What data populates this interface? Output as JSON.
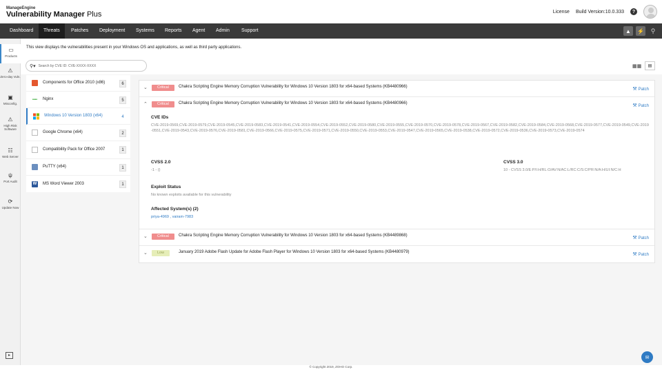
{
  "header": {
    "brand_small": "ManageEngine",
    "brand_name_bold": "Vulnerability Manager",
    "brand_name_light": " Plus",
    "license_label": "License",
    "build_version": "Build Version:10.0.333",
    "help_glyph": "?"
  },
  "nav": {
    "items": [
      "Dashboard",
      "Threats",
      "Patches",
      "Deployment",
      "Systems",
      "Reports",
      "Agent",
      "Admin",
      "Support"
    ],
    "active": "Threats"
  },
  "rail": {
    "items": [
      {
        "label": "Products",
        "icon": "laptop-icon"
      },
      {
        "label": "Zero-day Vuln.",
        "icon": "warning-icon"
      },
      {
        "label": "Misconfig.",
        "icon": "monitor-icon"
      },
      {
        "label": "High Risk Software",
        "icon": "alert-icon"
      },
      {
        "label": "Web Server",
        "icon": "server-icon"
      },
      {
        "label": "Port Audit",
        "icon": "usb-icon"
      },
      {
        "label": "Update Now",
        "icon": "refresh-icon"
      }
    ]
  },
  "intro_text": "This view displays the vulnerabilities present in your Windows OS and applications, as well as third party applications.",
  "search": {
    "placeholder": "Search by CVE ID: CVE-XXXX-XXXX"
  },
  "products": [
    {
      "name": "Components for Office 2010 (x86)",
      "count": "6",
      "icon": "office-icon"
    },
    {
      "name": "Nginx",
      "count": "5",
      "icon": "nginx-icon"
    },
    {
      "name": "Windows 10 Version 1803 (x64)",
      "count": "4",
      "icon": "windows-icon",
      "active": true
    },
    {
      "name": "Google Chrome (x64)",
      "count": "2",
      "icon": "file-icon"
    },
    {
      "name": "Compatibility Pack for Office 2007",
      "count": "1",
      "icon": "file-icon"
    },
    {
      "name": "PuTTY (x64)",
      "count": "1",
      "icon": "putty-icon"
    },
    {
      "name": "MS Word Viewer 2003",
      "count": "1",
      "icon": "word-icon"
    }
  ],
  "vulnerabilities": [
    {
      "severity": "Critical",
      "title": "Chakra Scripting Engine Memory Corruption Vulnerability for Windows 10 Version 1803 for x64-based Systems (KB4480966)",
      "action": "Patch"
    },
    {
      "severity": "Critical",
      "title": "Chakra Scripting Engine Memory Corruption Vulnerability for Windows 10 Version 1803 for x64-based Systems (KB4480966)",
      "action": "Patch",
      "expanded": true
    },
    {
      "severity": "Critical",
      "title": "Chakra Scripting Engine Memory Corruption Vulnerability for Windows 10 Version 1803 for x64-based Systems (KB4489868)",
      "action": "Patch"
    },
    {
      "severity": "Low",
      "title": "January 2019 Adobe Flash Update for Adobe Flash Player for Windows 10 Version 1803 for x64-based Systems (KB4480979)",
      "action": "Patch"
    }
  ],
  "details": {
    "cve_heading": "CVE IDs",
    "cve_list": "CVE-2019-0569,CVE-2019-0579,CVE-2019-0545,CVE-2019-0583,CVE-2019-0541,CVE-2019-0554,CVE-2019-0552,CVE-2019-0580,CVE-2019-0555,CVE-2019-0570,CVE-2019-0578,CVE-2019-0567,CVE-2019-0582,CVE-2019-0584,CVE-2019-0568,CVE-2019-0577,CVE-2019-0549,CVE-2019-0551,CVE-2019-0543,CVE-2019-0576,CVE-2019-0581,CVE-2019-0566,CVE-2019-0575,CVE-2019-0571,CVE-2019-0550,CVE-2019-0553,CVE-2019-0547,CVE-2019-0565,CVE-2019-0538,CVE-2019-0572,CVE-2019-0536,CVE-2019-0573,CVE-2019-0574",
    "cvss2_heading": "CVSS 2.0",
    "cvss2_value": "-1 - ()",
    "cvss3_heading": "CVSS 3.0",
    "cvss3_value": "10 - CVSS 3.0/E:P/I:H/RL:O/AV:N/AC:L/RC:C/S:C/PR:N/A:H/UI:N/C:H",
    "exploit_heading": "Exploit Status",
    "exploit_value": "No known exploits available for this vulnerability",
    "affected_heading": "Affected System(s) (2)",
    "affected_systems": "priya-4969 , vairam-7983"
  },
  "footer": "© Copyright 2019, ZOHO Corp.",
  "colors": {
    "critical": "#f08d8d",
    "low": "#e6eeb8",
    "accent": "#2f7bc4",
    "navbar": "#3a3a3a"
  }
}
